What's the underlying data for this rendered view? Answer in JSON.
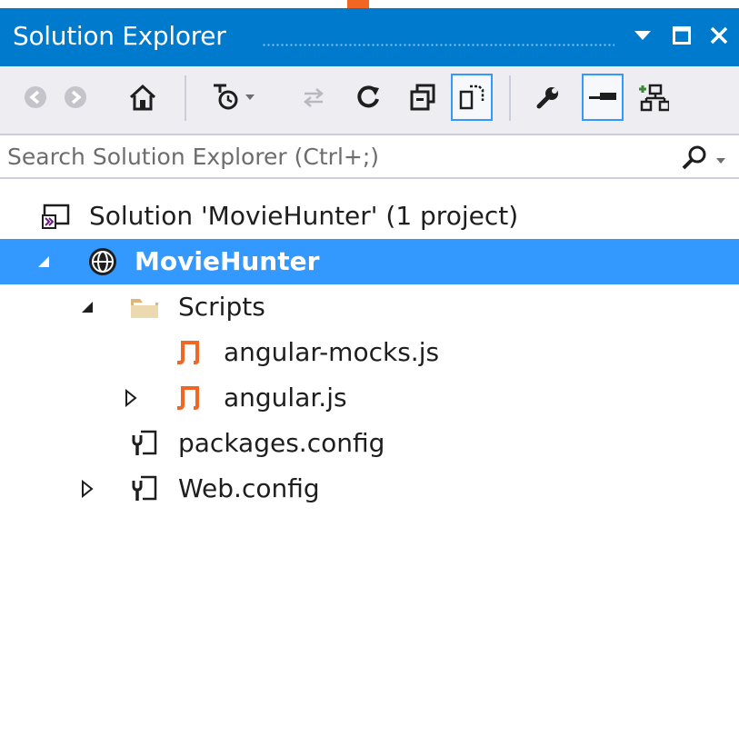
{
  "window": {
    "title": "Solution Explorer",
    "controls": {
      "dropdown_icon": "dropdown-arrow-icon",
      "maximize_icon": "maximize-icon",
      "close_icon": "close-icon"
    }
  },
  "toolbar": {
    "buttons": [
      {
        "name": "back-button",
        "icon": "back-arrow-icon"
      },
      {
        "name": "forward-button",
        "icon": "forward-arrow-icon"
      },
      {
        "name": "home-button",
        "icon": "home-icon"
      },
      {
        "name": "pending-changes-filter-button",
        "icon": "clock-filter-icon"
      },
      {
        "name": "sync-with-active-document-button",
        "icon": "sync-arrows-icon"
      },
      {
        "name": "refresh-button",
        "icon": "refresh-icon"
      },
      {
        "name": "collapse-all-button",
        "icon": "collapse-all-icon"
      },
      {
        "name": "show-all-files-button",
        "icon": "show-all-files-icon",
        "toggled": true
      },
      {
        "name": "properties-button",
        "icon": "wrench-icon"
      },
      {
        "name": "preview-selected-items-button",
        "icon": "preview-icon",
        "toggled": true
      },
      {
        "name": "class-view-button",
        "icon": "class-diagram-icon"
      }
    ],
    "accent": "#3399ff"
  },
  "search": {
    "placeholder": "Search Solution Explorer (Ctrl+;)",
    "value": "",
    "icon": "search-icon"
  },
  "tree": {
    "items": [
      {
        "label": "Solution 'MovieHunter' (1 project)",
        "icon": "solution-icon",
        "expander": "none",
        "selected": false
      },
      {
        "label": "MovieHunter",
        "icon": "web-project-globe-icon",
        "expander": "expanded",
        "selected": true
      },
      {
        "label": "Scripts",
        "icon": "folder-icon",
        "expander": "expanded",
        "selected": false
      },
      {
        "label": "angular-mocks.js",
        "icon": "javascript-file-icon",
        "expander": "none",
        "selected": false
      },
      {
        "label": "angular.js",
        "icon": "javascript-file-icon",
        "expander": "collapsed",
        "selected": false
      },
      {
        "label": "packages.config",
        "icon": "config-file-icon",
        "expander": "none",
        "selected": false
      },
      {
        "label": "Web.config",
        "icon": "config-file-icon",
        "expander": "collapsed",
        "selected": false
      }
    ]
  },
  "colors": {
    "title_bar": "#007acc",
    "selection": "#3399ff",
    "toolbar_bg": "#eeeef2",
    "js_icon": "#f26522"
  }
}
